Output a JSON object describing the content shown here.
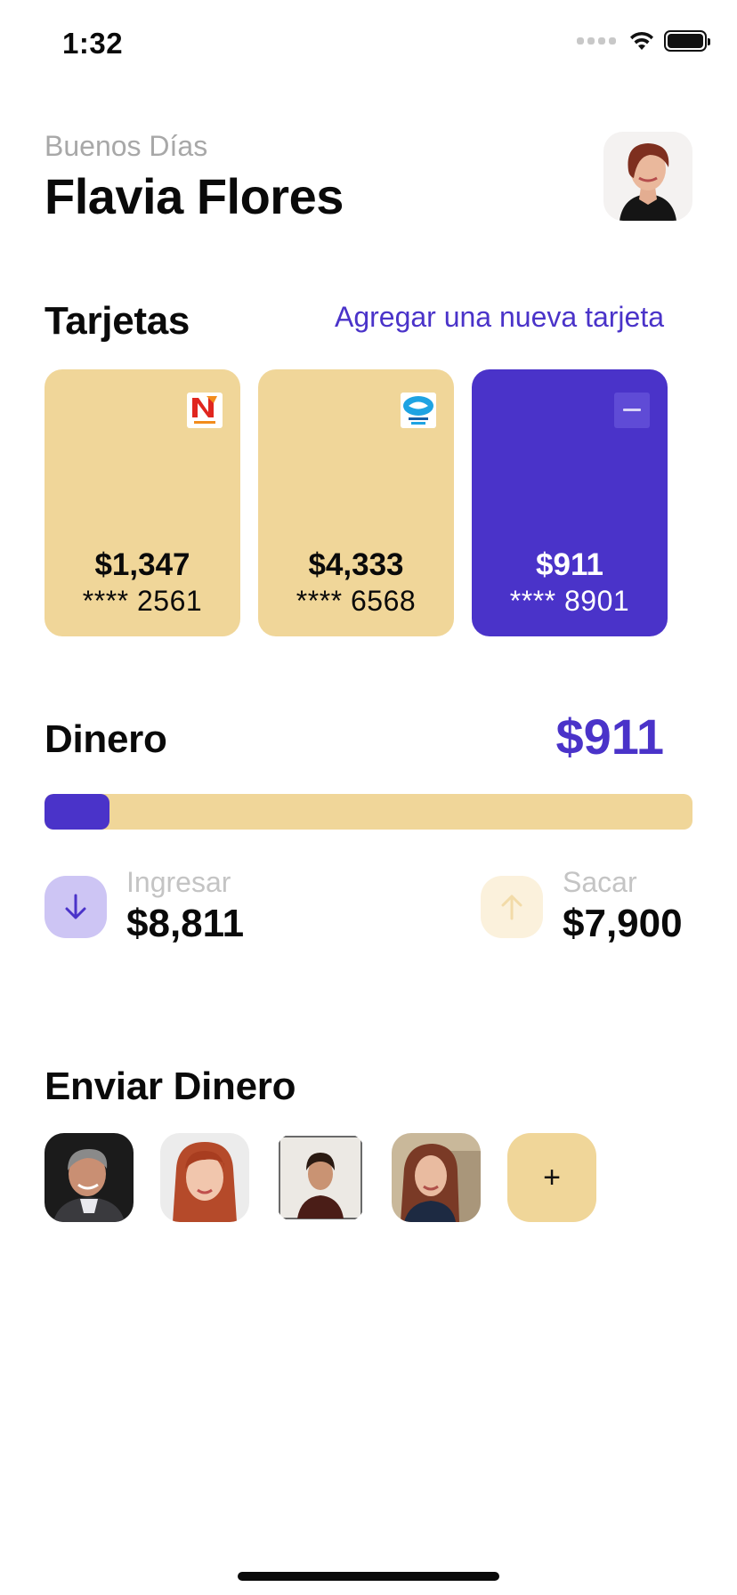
{
  "status_bar": {
    "time": "1:32"
  },
  "header": {
    "greeting": "Buenos Días",
    "name": "Flavia Flores"
  },
  "cards_section": {
    "title": "Tarjetas",
    "add_link": "Agregar una nueva tarjeta",
    "cards": [
      {
        "amount": "$1,347",
        "number": "**** 2561",
        "logo": "naranja-logo-icon",
        "color": "#f0d699"
      },
      {
        "amount": "$4,333",
        "number": "**** 6568",
        "logo": "mercado-pago-logo-icon",
        "color": "#f0d699"
      },
      {
        "amount": "$911",
        "number": "**** 8901",
        "logo": "bank-logo-icon",
        "color": "#4a33c9"
      }
    ]
  },
  "money_section": {
    "title": "Dinero",
    "total": "$911",
    "progress_fraction": 0.1,
    "income": {
      "label": "Ingresar",
      "value": "$8,811",
      "icon": "arrow-down-icon"
    },
    "expense": {
      "label": "Sacar",
      "value": "$7,900",
      "icon": "arrow-up-icon"
    }
  },
  "send_section": {
    "title": "Enviar Dinero",
    "add_symbol": "+"
  },
  "colors": {
    "accent": "#4a33c9",
    "tan": "#f0d699",
    "muted_text": "#a8a8a8"
  }
}
